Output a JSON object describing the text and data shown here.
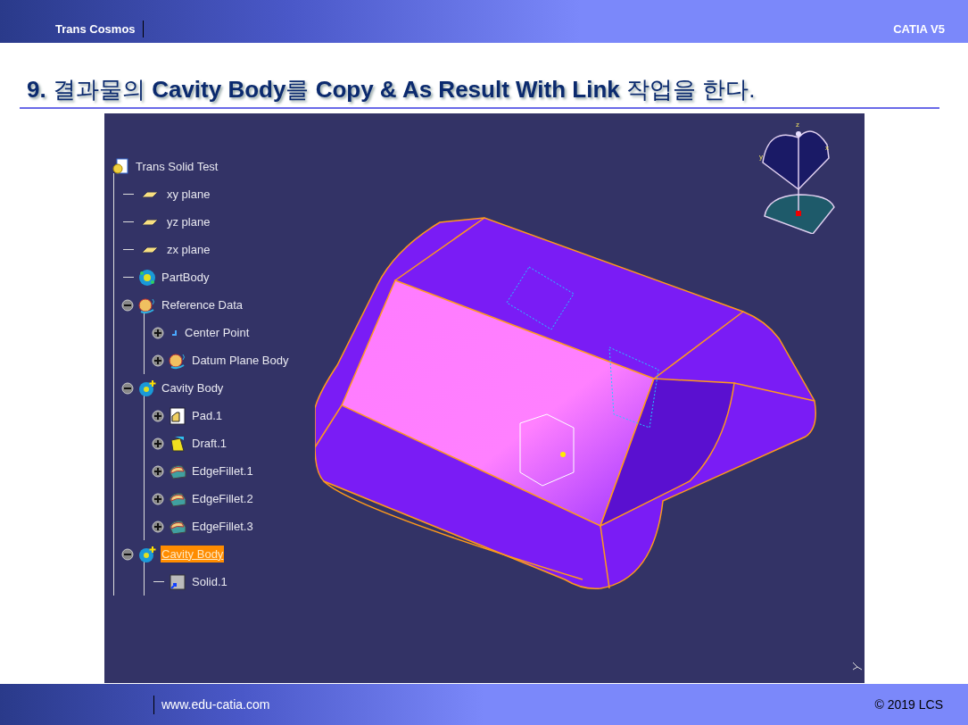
{
  "header": {
    "left": "Trans Cosmos",
    "right": "CATIA V5"
  },
  "title": "**9.** 결과물의 **Cavity Body**를 **Copy & As Result With Link** 작업을 한다.",
  "tree": {
    "label": "Trans Solid Test",
    "kind": "part",
    "selected": false,
    "children": [
      {
        "label": "xy plane",
        "kind": "plane",
        "selected": false
      },
      {
        "label": "yz plane",
        "kind": "plane",
        "selected": false
      },
      {
        "label": "zx plane",
        "kind": "plane",
        "selected": false
      },
      {
        "label": "PartBody",
        "kind": "body",
        "selected": false
      },
      {
        "label": "Reference Data",
        "kind": "refdata",
        "selected": false,
        "expanded": true,
        "children": [
          {
            "label": "Center Point",
            "kind": "point",
            "selected": false,
            "expanded": false
          },
          {
            "label": "Datum Plane Body",
            "kind": "refdata",
            "selected": false,
            "expanded": false
          }
        ]
      },
      {
        "label": "Cavity Body",
        "kind": "newbody",
        "selected": false,
        "expanded": true,
        "children": [
          {
            "label": "Pad.1",
            "kind": "pad",
            "selected": false,
            "expanded": false
          },
          {
            "label": "Draft.1",
            "kind": "draft",
            "selected": false,
            "expanded": false
          },
          {
            "label": "EdgeFillet.1",
            "kind": "fillet",
            "selected": false,
            "expanded": false
          },
          {
            "label": "EdgeFillet.2",
            "kind": "fillet",
            "selected": false,
            "expanded": false
          },
          {
            "label": "EdgeFillet.3",
            "kind": "fillet",
            "selected": false,
            "expanded": false
          }
        ]
      },
      {
        "label": "Cavity Body",
        "kind": "newbody",
        "selected": true,
        "expanded": true,
        "children": [
          {
            "label": "Solid.1",
            "kind": "solid",
            "selected": false
          }
        ]
      }
    ]
  },
  "compass": {
    "z": "z",
    "y": "y",
    "x": "x"
  },
  "footer": {
    "url": "www.edu-catia.com",
    "copyright": "© 2019 LCS"
  }
}
